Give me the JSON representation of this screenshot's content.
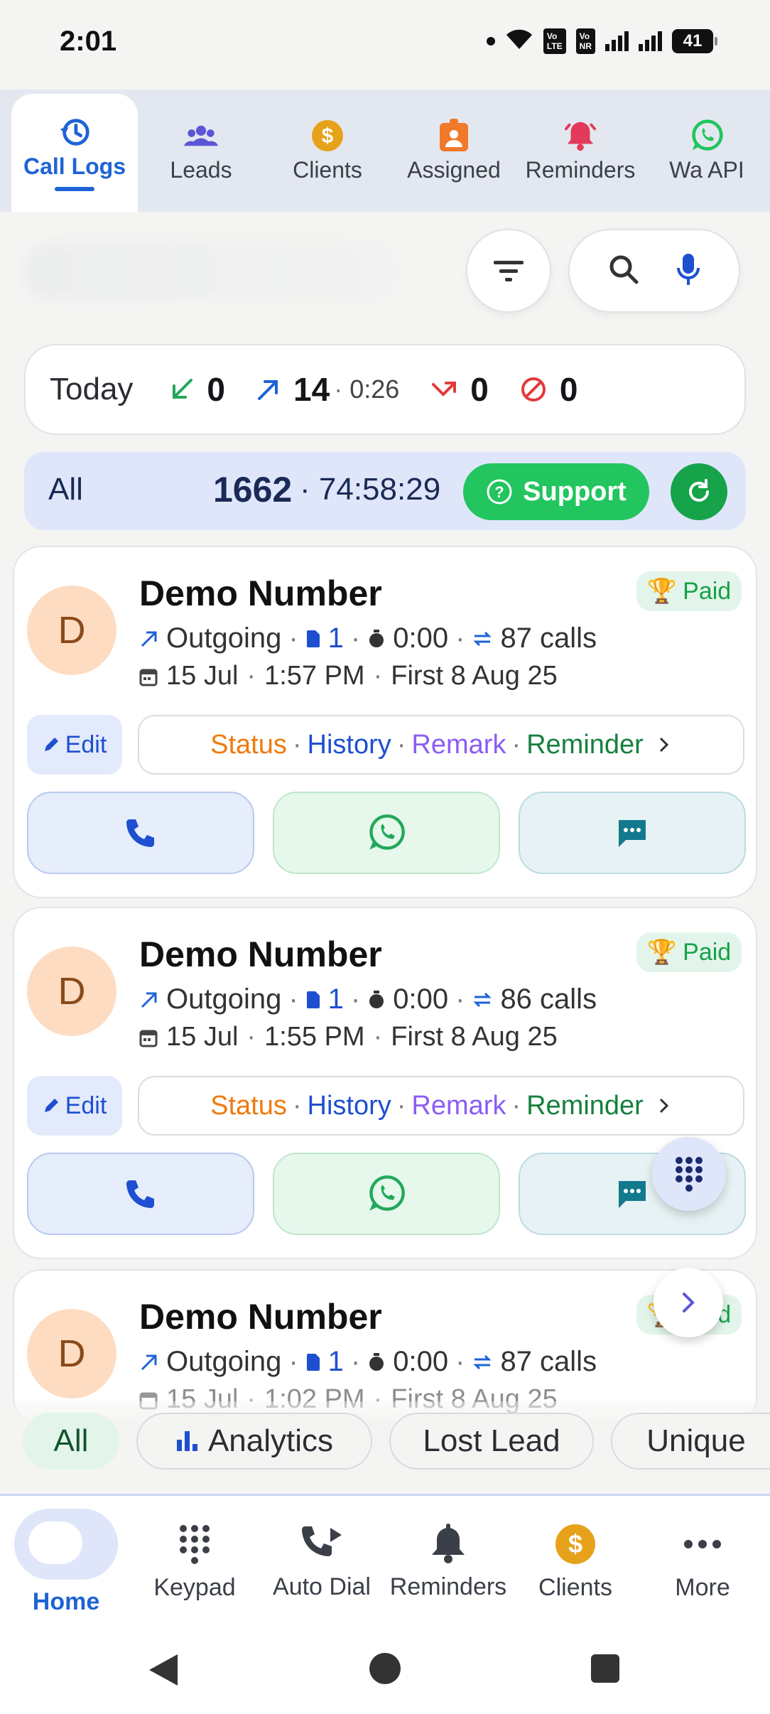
{
  "status_bar": {
    "time": "2:01",
    "battery": "41"
  },
  "top_tabs": [
    {
      "label": "Call Logs",
      "icon": "call-log-history-icon",
      "color": "#1e63d6"
    },
    {
      "label": "Leads",
      "icon": "people-icon",
      "color": "#5b56d6"
    },
    {
      "label": "Clients",
      "icon": "dollar-icon",
      "color": "#e6a21a"
    },
    {
      "label": "Assigned",
      "icon": "badge-icon",
      "color": "#f07a2a"
    },
    {
      "label": "Reminders",
      "icon": "bell-alert-icon",
      "color": "#e23a5a"
    },
    {
      "label": "Wa API",
      "icon": "whatsapp-icon",
      "color": "#22c55e"
    }
  ],
  "today": {
    "label": "Today",
    "incoming": "0",
    "outgoing": "14",
    "outgoing_duration": "0:26",
    "missed": "0",
    "rejected": "0"
  },
  "all_row": {
    "label": "All",
    "count": "1662",
    "duration": "74:58:29",
    "support_label": "Support"
  },
  "calls": [
    {
      "initial": "D",
      "name": "Demo Number",
      "badge": "Paid",
      "direction": "Outgoing",
      "sim": "1",
      "duration": "0:00",
      "calls": "87 calls",
      "date": "15 Jul",
      "time": "1:57 PM",
      "first": "First 8 Aug 25"
    },
    {
      "initial": "D",
      "name": "Demo Number",
      "badge": "Paid",
      "direction": "Outgoing",
      "sim": "1",
      "duration": "0:00",
      "calls": "86 calls",
      "date": "15 Jul",
      "time": "1:55 PM",
      "first": "First 8 Aug 25"
    },
    {
      "initial": "D",
      "name": "Demo Number",
      "badge": "Paid",
      "direction": "Outgoing",
      "sim": "1",
      "duration": "0:00",
      "calls": "87 calls",
      "date": "15 Jul",
      "time": "1:02 PM",
      "first": "First 8 Aug 25"
    }
  ],
  "card_actions": {
    "edit": "Edit",
    "status": "Status",
    "history": "History",
    "remark": "Remark",
    "reminder": "Reminder"
  },
  "chips": {
    "all": "All",
    "analytics": "Analytics",
    "lost_lead": "Lost Lead",
    "unique": "Unique"
  },
  "bottom_nav": [
    {
      "label": "Home",
      "icon": "home-icon"
    },
    {
      "label": "Keypad",
      "icon": "keypad-icon"
    },
    {
      "label": "Auto Dial",
      "icon": "auto-dial-icon"
    },
    {
      "label": "Reminders",
      "icon": "bell-icon"
    },
    {
      "label": "Clients",
      "icon": "dollar-icon"
    },
    {
      "label": "More",
      "icon": "more-icon"
    }
  ]
}
